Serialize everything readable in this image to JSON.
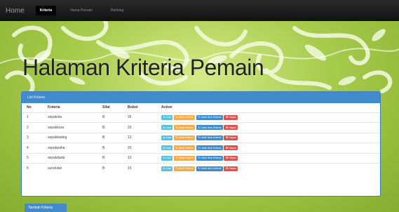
{
  "navbar": {
    "brand": "Home",
    "items": [
      {
        "label": "Kriteria",
        "active": true
      },
      {
        "label": "Nama Pemain",
        "active": false
      },
      {
        "label": "Ranking",
        "active": false
      }
    ]
  },
  "page": {
    "title": "Halaman Kriteria Pemain"
  },
  "panel": {
    "heading": "List Kriteria",
    "columns": [
      "No",
      "Kriteria",
      "Sifat",
      "Bobot",
      "Action"
    ],
    "actions": {
      "view": "Lihat",
      "edit": "Ubah Kriteria",
      "edit_item": "Ubah Item Kriteria",
      "delete": "Hapus"
    },
    "rows": [
      {
        "no": "1",
        "kriteria": "sepakola",
        "sifat": "B",
        "bobot": "25"
      },
      {
        "no": "2",
        "kriteria": "sepakkura",
        "sifat": "B",
        "bobot": "20"
      },
      {
        "no": "3",
        "kriteria": "sepakbadeg",
        "sifat": "B",
        "bobot": "10"
      },
      {
        "no": "4",
        "kriteria": "sepakpaha",
        "sifat": "B",
        "bobot": "20"
      },
      {
        "no": "5",
        "kriteria": "sepakdada",
        "sifat": "B",
        "bobot": "10"
      },
      {
        "no": "6",
        "kriteria": "sundulan",
        "sifat": "B",
        "bobot": "15"
      }
    ]
  },
  "footer": {
    "add_button": "Tambah Kriteria"
  },
  "colors": {
    "primary": "#428bca",
    "info": "#5bc0de",
    "warning": "#f0ad4e",
    "danger": "#d9534f",
    "background_green": "#8fb83a",
    "navbar": "#1a1a1a"
  },
  "icons": {
    "view": "info-circle-icon",
    "edit": "edit-icon",
    "edit_item": "refresh-icon",
    "delete": "times-icon"
  }
}
